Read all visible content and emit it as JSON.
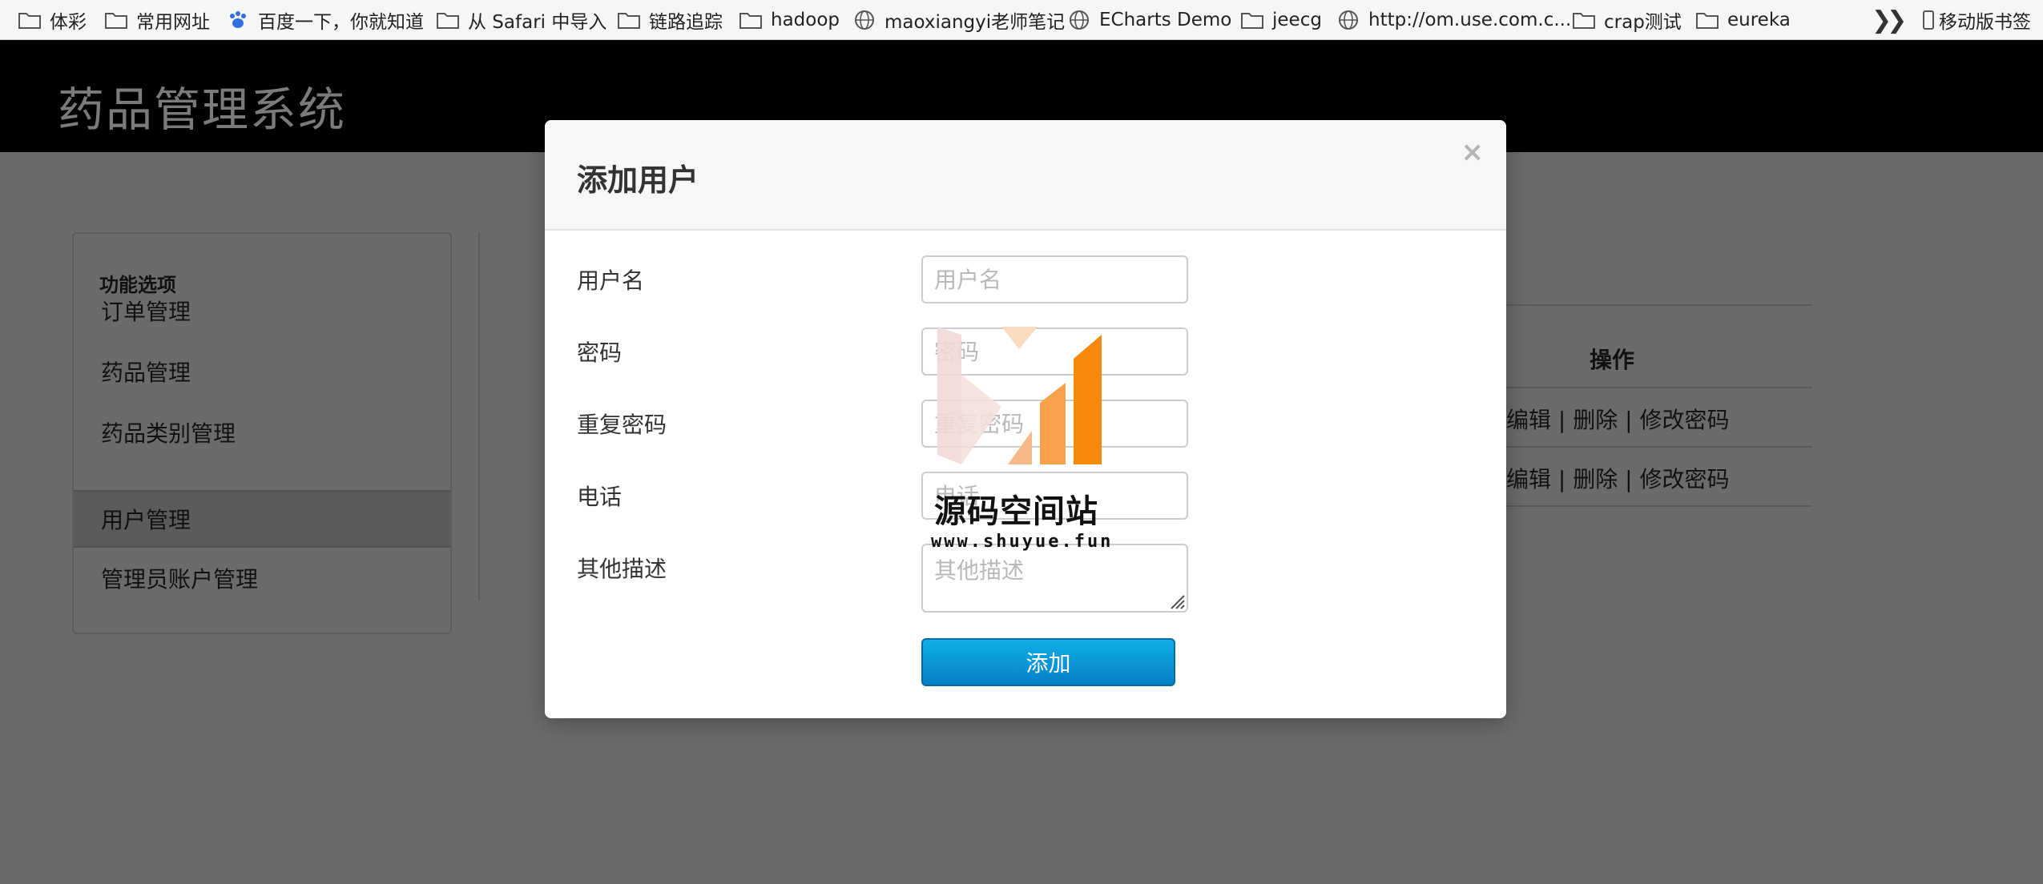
{
  "bookmarks": {
    "items": [
      {
        "label": "体彩",
        "icon": "folder-icon"
      },
      {
        "label": "常用网址",
        "icon": "folder-icon"
      },
      {
        "label": "百度一下，你就知道",
        "icon": "baidu-paw-icon"
      },
      {
        "label": "从 Safari 中导入",
        "icon": "folder-icon"
      },
      {
        "label": "链路追踪",
        "icon": "folder-icon"
      },
      {
        "label": "hadoop",
        "icon": "folder-icon"
      },
      {
        "label": "maoxiangyi老师笔记",
        "icon": "globe-icon"
      },
      {
        "label": "ECharts Demo",
        "icon": "globe-icon"
      },
      {
        "label": "jeecg",
        "icon": "folder-icon"
      },
      {
        "label": "http://om.use.com.c...",
        "icon": "globe-icon"
      },
      {
        "label": "crap测试",
        "icon": "folder-icon"
      },
      {
        "label": "eureka",
        "icon": "folder-icon"
      }
    ],
    "overflow_icon": "double-chevron-icon",
    "mobile_label": "移动版书签"
  },
  "app": {
    "title": "药品管理系统"
  },
  "sidebar": {
    "heading": "功能选项",
    "items": [
      {
        "label": "订单管理"
      },
      {
        "label": "药品管理"
      },
      {
        "label": "药品类别管理"
      },
      {
        "label": "用户管理",
        "active": true
      },
      {
        "label": "管理员账户管理"
      }
    ]
  },
  "table": {
    "action_header": "操作",
    "rows": [
      {
        "actions": "编辑 | 删除 | 修改密码"
      },
      {
        "actions": "编辑 | 删除 | 修改密码"
      }
    ]
  },
  "modal": {
    "title": "添加用户",
    "close_icon": "×",
    "fields": {
      "username": {
        "label": "用户名",
        "placeholder": "用户名",
        "value": ""
      },
      "password": {
        "label": "密码",
        "placeholder": "密码",
        "value": ""
      },
      "repeat_password": {
        "label": "重复密码",
        "placeholder": "重复密码",
        "value": ""
      },
      "phone": {
        "label": "电话",
        "placeholder": "电话",
        "value": ""
      },
      "description": {
        "label": "其他描述",
        "placeholder": "其他描述",
        "value": ""
      }
    },
    "submit_label": "添加"
  },
  "watermark": {
    "text": "源码空间站",
    "url": "www.shuyue.fun"
  },
  "colors": {
    "overlay": "#6b6b6b",
    "header": "#000000",
    "button": "#0a9ad9",
    "watermark_orange": "#f7890c"
  }
}
